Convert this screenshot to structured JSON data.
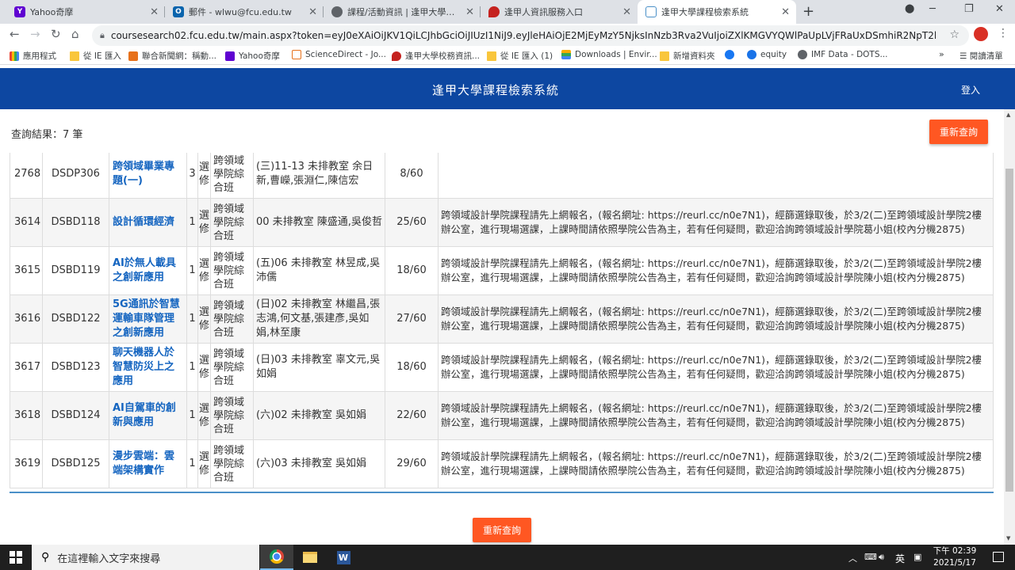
{
  "browser": {
    "tabs": [
      {
        "title": "Yahoo奇摩",
        "favicon": "yahoo-icon",
        "color": "#5f01d1"
      },
      {
        "title": "郵件 - wlwu@fcu.edu.tw",
        "favicon": "outlook-icon",
        "color": "#0a64ad"
      },
      {
        "title": "課程/活動資訊 | 逢甲大學跨領域...",
        "favicon": "globe-icon",
        "color": "#5f6368"
      },
      {
        "title": "逢甲人資訊服務入口",
        "favicon": "map-pin-icon",
        "color": "#c5221f"
      },
      {
        "title": "逢甲大學課程檢索系統",
        "favicon": "page-icon",
        "color": "#4a90c8",
        "active": true
      }
    ],
    "url": "coursesearch02.fcu.edu.tw/main.aspx?token=eyJ0eXAiOiJKV1QiLCJhbGciOiJIUzI1NiJ9.eyJleHAiOjE2MjEyMzY5NjksInNzb3Rva2VuIjoiZXlKMGVYQWlPaUpLVjFRaUxDSmhiR2NpT2lKSVV6STF...",
    "bookmarks": [
      {
        "label": "應用程式",
        "icon": "apps-grid-icon"
      },
      {
        "label": "從 IE 匯入",
        "icon": "folder-icon"
      },
      {
        "label": "聯合新聞網：稱動...",
        "icon": "udn-icon"
      },
      {
        "label": "Yahoo奇摩",
        "icon": "yahoo-icon"
      },
      {
        "label": "ScienceDirect - Jo...",
        "icon": "elsevier-icon"
      },
      {
        "label": "逢甲大學校務資訊...",
        "icon": "map-pin-icon"
      },
      {
        "label": "從 IE 匯入 (1)",
        "icon": "folder-icon"
      },
      {
        "label": "Downloads | Envir...",
        "icon": "bars-icon"
      },
      {
        "label": "新增資料夾",
        "icon": "folder-icon"
      },
      {
        "label": "",
        "icon": "facebook-icon"
      },
      {
        "label": "equity",
        "icon": "equity-icon"
      },
      {
        "label": "IMF Data - DOTS...",
        "icon": "globe-icon"
      }
    ],
    "more": "»",
    "reading_list": "閱讀清單"
  },
  "page": {
    "site_title": "逢甲大學課程檢索系統",
    "login": "登入",
    "result_count": "查詢結果：7 筆",
    "requery_button": "重新查詢",
    "rows": [
      {
        "id": "2768",
        "code": "DSDP306",
        "name": "跨領域畢業專題(一)",
        "credits": "3",
        "type": "選修",
        "dept": "跨領域學院綜合班",
        "time": "(三)11-13 未排教室 余日新,曹嶸,張淵仁,陳信宏",
        "enroll": "8/60",
        "note": ""
      },
      {
        "id": "3614",
        "code": "DSBD118",
        "name": "設計循環經濟",
        "credits": "1",
        "type": "選修",
        "dept": "跨領域學院綜合班",
        "time": "00 未排教室 陳盛通,吳俊哲",
        "enroll": "25/60",
        "note": "跨領域設計學院課程請先上網報名，(報名網址: https://reurl.cc/n0e7N1)，經篩選錄取後，於3/2(二)至跨領域設計學院2樓辦公室，進行現場選課，上課時間請依照學院公告為主，若有任何疑問，歡迎洽詢跨領域設計學院葛小姐(校內分機2875)"
      },
      {
        "id": "3615",
        "code": "DSBD119",
        "name": "AI於無人載具之創新應用",
        "credits": "1",
        "type": "選修",
        "dept": "跨領域學院綜合班",
        "time": "(五)06 未排教室 林昱成,吳沛儒",
        "enroll": "18/60",
        "note": "跨領域設計學院課程請先上網報名，(報名網址: https://reurl.cc/n0e7N1)，經篩選錄取後，於3/2(二)至跨領域設計學院2樓辦公室，進行現場選課，上課時間請依照學院公告為主，若有任何疑問，歡迎洽詢跨領域設計學院陳小姐(校內分機2875)"
      },
      {
        "id": "3616",
        "code": "DSBD122",
        "name": "5G通訊於智慧運輸車隊管理之創新應用",
        "credits": "1",
        "type": "選修",
        "dept": "跨領域學院綜合班",
        "time": "(日)02 未排教室 林繼昌,張志鴻,何文基,張建彥,吳如娟,林至康",
        "enroll": "27/60",
        "note": "跨領域設計學院課程請先上網報名，(報名網址: https://reurl.cc/n0e7N1)，經篩選錄取後，於3/2(二)至跨領域設計學院2樓辦公室，進行現場選課，上課時間請依照學院公告為主，若有任何疑問，歡迎洽詢跨領域設計學院陳小姐(校內分機2875)"
      },
      {
        "id": "3617",
        "code": "DSBD123",
        "name": "聊天機器人於智慧防災上之應用",
        "credits": "1",
        "type": "選修",
        "dept": "跨領域學院綜合班",
        "time": "(日)03 未排教室 辜文元,吳如娟",
        "enroll": "18/60",
        "note": "跨領域設計學院課程請先上網報名，(報名網址: https://reurl.cc/n0e7N1)，經篩選錄取後，於3/2(二)至跨領域設計學院2樓辦公室，進行現場選課，上課時間請依照學院公告為主，若有任何疑問，歡迎洽詢跨領域設計學院陳小姐(校內分機2875)"
      },
      {
        "id": "3618",
        "code": "DSBD124",
        "name": "AI自駕車的創新與應用",
        "credits": "1",
        "type": "選修",
        "dept": "跨領域學院綜合班",
        "time": "(六)02 未排教室 吳如娟",
        "enroll": "22/60",
        "note": "跨領域設計學院課程請先上網報名，(報名網址: https://reurl.cc/n0e7N1)，經篩選錄取後，於3/2(二)至跨領域設計學院2樓辦公室，進行現場選課，上課時間請依照學院公告為主，若有任何疑問，歡迎洽詢跨領域設計學院陳小姐(校內分機2875)"
      },
      {
        "id": "3619",
        "code": "DSBD125",
        "name": "漫步雲端：雲端架構實作",
        "credits": "1",
        "type": "選修",
        "dept": "跨領域學院綜合班",
        "time": "(六)03 未排教室 吳如娟",
        "enroll": "29/60",
        "note": "跨領域設計學院課程請先上網報名，(報名網址: https://reurl.cc/n0e7N1)，經篩選錄取後，於3/2(二)至跨領域設計學院2樓辦公室，進行現場選課，上課時間請依照學院公告為主，若有任何疑問，歡迎洽詢跨領域設計學院陳小姐(校內分機2875)"
      }
    ]
  },
  "taskbar": {
    "search_placeholder": "在這裡輸入文字來搜尋",
    "ime": "英",
    "time": "下午 02:39",
    "date": "2021/5/17"
  },
  "colors": {
    "header_bg": "#0d47a1",
    "button_bg": "#ff5722",
    "course_link": "#1565c0"
  }
}
